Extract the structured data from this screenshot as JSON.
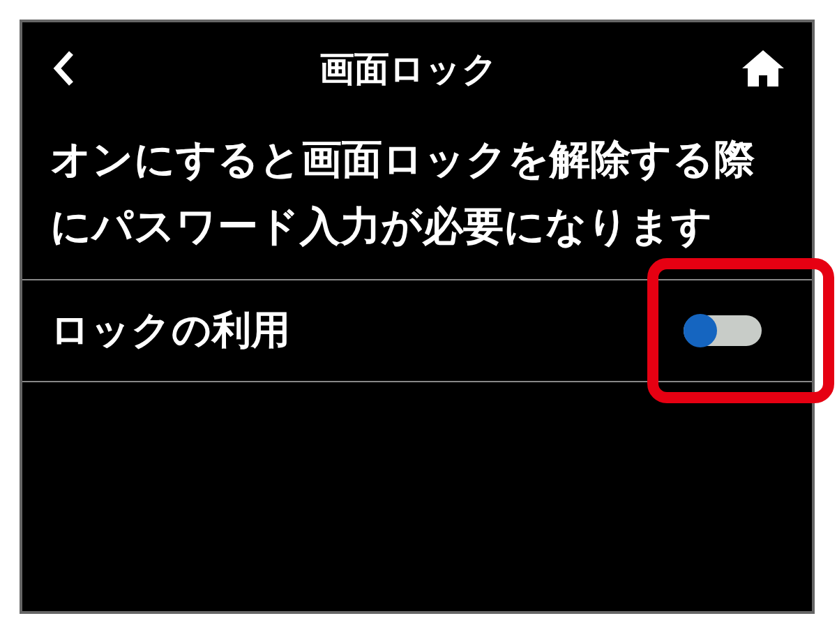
{
  "header": {
    "title": "画面ロック"
  },
  "description": "オンにすると画面ロックを解除する際にパスワード入力が必要になります",
  "settings": [
    {
      "label": "ロックの利用",
      "on": false,
      "highlighted": true
    }
  ]
}
